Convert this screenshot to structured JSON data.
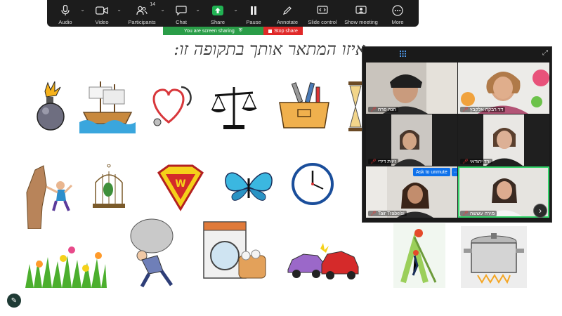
{
  "toolbar": {
    "audio_label": "Audio",
    "video_label": "Video",
    "participants_label": "Participants",
    "participants_count": "14",
    "chat_label": "Chat",
    "share_label": "Share",
    "pause_label": "Pause",
    "annotate_label": "Annotate",
    "slide_control_label": "Slide control",
    "show_meeting_label": "Show meeting",
    "more_label": "More"
  },
  "share_banner": {
    "text": "You are screen sharing",
    "stop_label": "Stop share"
  },
  "slide": {
    "title": "איזו המתאר אותך בתקופה זו:"
  },
  "gallery": {
    "tiles": [
      {
        "name": "חנה פרח",
        "muted": true
      },
      {
        "name": "דר רבקה אלקבץ",
        "muted": true
      },
      {
        "name": "זיוית דידי",
        "muted": true
      },
      {
        "name": "ורד יהודאי",
        "muted": true
      },
      {
        "name": "Tair Trabelsi",
        "muted": true
      },
      {
        "name": "מירה עששה",
        "muted": true
      }
    ],
    "ask_to_unmute": "Ask to unmute",
    "more_dots": "···"
  },
  "colors": {
    "toolbar_bg": "#1c1c1c",
    "share_green": "#2a9d48",
    "stop_red": "#e02828",
    "zoom_blue": "#0e71eb",
    "active_speaker": "#35d46b"
  },
  "icons": {
    "audio": "microphone-icon",
    "video": "camera-icon",
    "participants": "people-icon",
    "chat": "chat-bubble-icon",
    "share": "share-arrow-icon",
    "pause": "pause-icon",
    "annotate": "pencil-icon",
    "slide_control": "slide-control-icon",
    "show_meeting": "monitor-icon",
    "more": "ellipsis-icon"
  }
}
